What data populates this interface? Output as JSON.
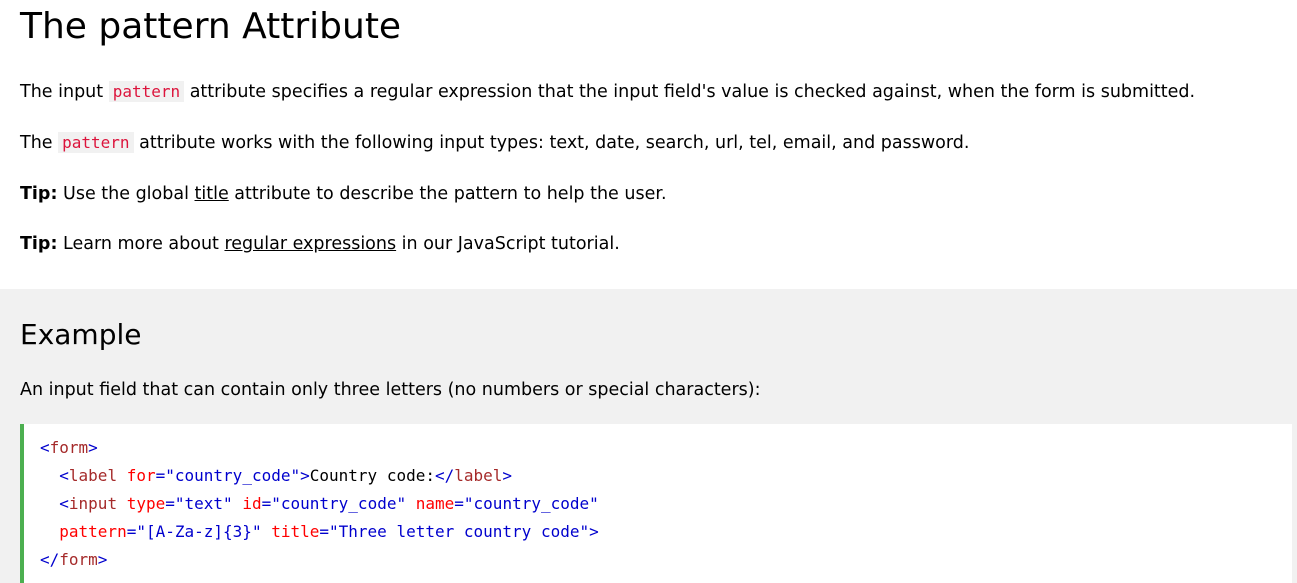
{
  "title": "The pattern Attribute",
  "para1": {
    "before": "The input ",
    "code": "pattern",
    "after": " attribute specifies a regular expression that the input field's value is checked against, when the form is submitted."
  },
  "para2": {
    "before": "The ",
    "code": "pattern",
    "after": " attribute works with the following input types: text, date, search, url, tel, email, and password."
  },
  "tip1": {
    "label": "Tip:",
    "before": " Use the global ",
    "link": "title",
    "after": " attribute to describe the pattern to help the user."
  },
  "tip2": {
    "label": "Tip:",
    "before": " Learn more about ",
    "link": "regular expressions",
    "after": " in our JavaScript tutorial."
  },
  "example": {
    "heading": "Example",
    "description": "An input field that can contain only three letters (no numbers or special characters):",
    "code": {
      "line1": {
        "lt": "<",
        "tag": "form",
        "gt": ">"
      },
      "line2": {
        "indent": "  ",
        "lt": "<",
        "tag": "label",
        "attr1": " for",
        "eq1": "=",
        "val1": "\"country_code\"",
        "gt": ">",
        "text": "Country code:",
        "close_lt": "</",
        "close_tag": "label",
        "close_gt": ">"
      },
      "line3": {
        "indent": "  ",
        "lt": "<",
        "tag": "input",
        "attr1": " type",
        "eq1": "=",
        "val1": "\"text\"",
        "attr2": " id",
        "eq2": "=",
        "val2": "\"country_code\"",
        "attr3": " name",
        "eq3": "=",
        "val3": "\"country_code\""
      },
      "line4": {
        "indent": "  ",
        "attr1": "pattern",
        "eq1": "=",
        "val1": "\"[A-Za-z]{3}\"",
        "attr2": " title",
        "eq2": "=",
        "val2": "\"Three letter country code\"",
        "gt": ">"
      },
      "line5": {
        "lt": "</",
        "tag": "form",
        "gt": ">"
      }
    }
  },
  "colors": {
    "inline_code": "#dc143c",
    "example_bg": "#f1f1f1",
    "code_border": "#4caf50",
    "code_tag": "#a52a2a",
    "code_attr": "#ff0000",
    "code_value": "#0000cd"
  }
}
